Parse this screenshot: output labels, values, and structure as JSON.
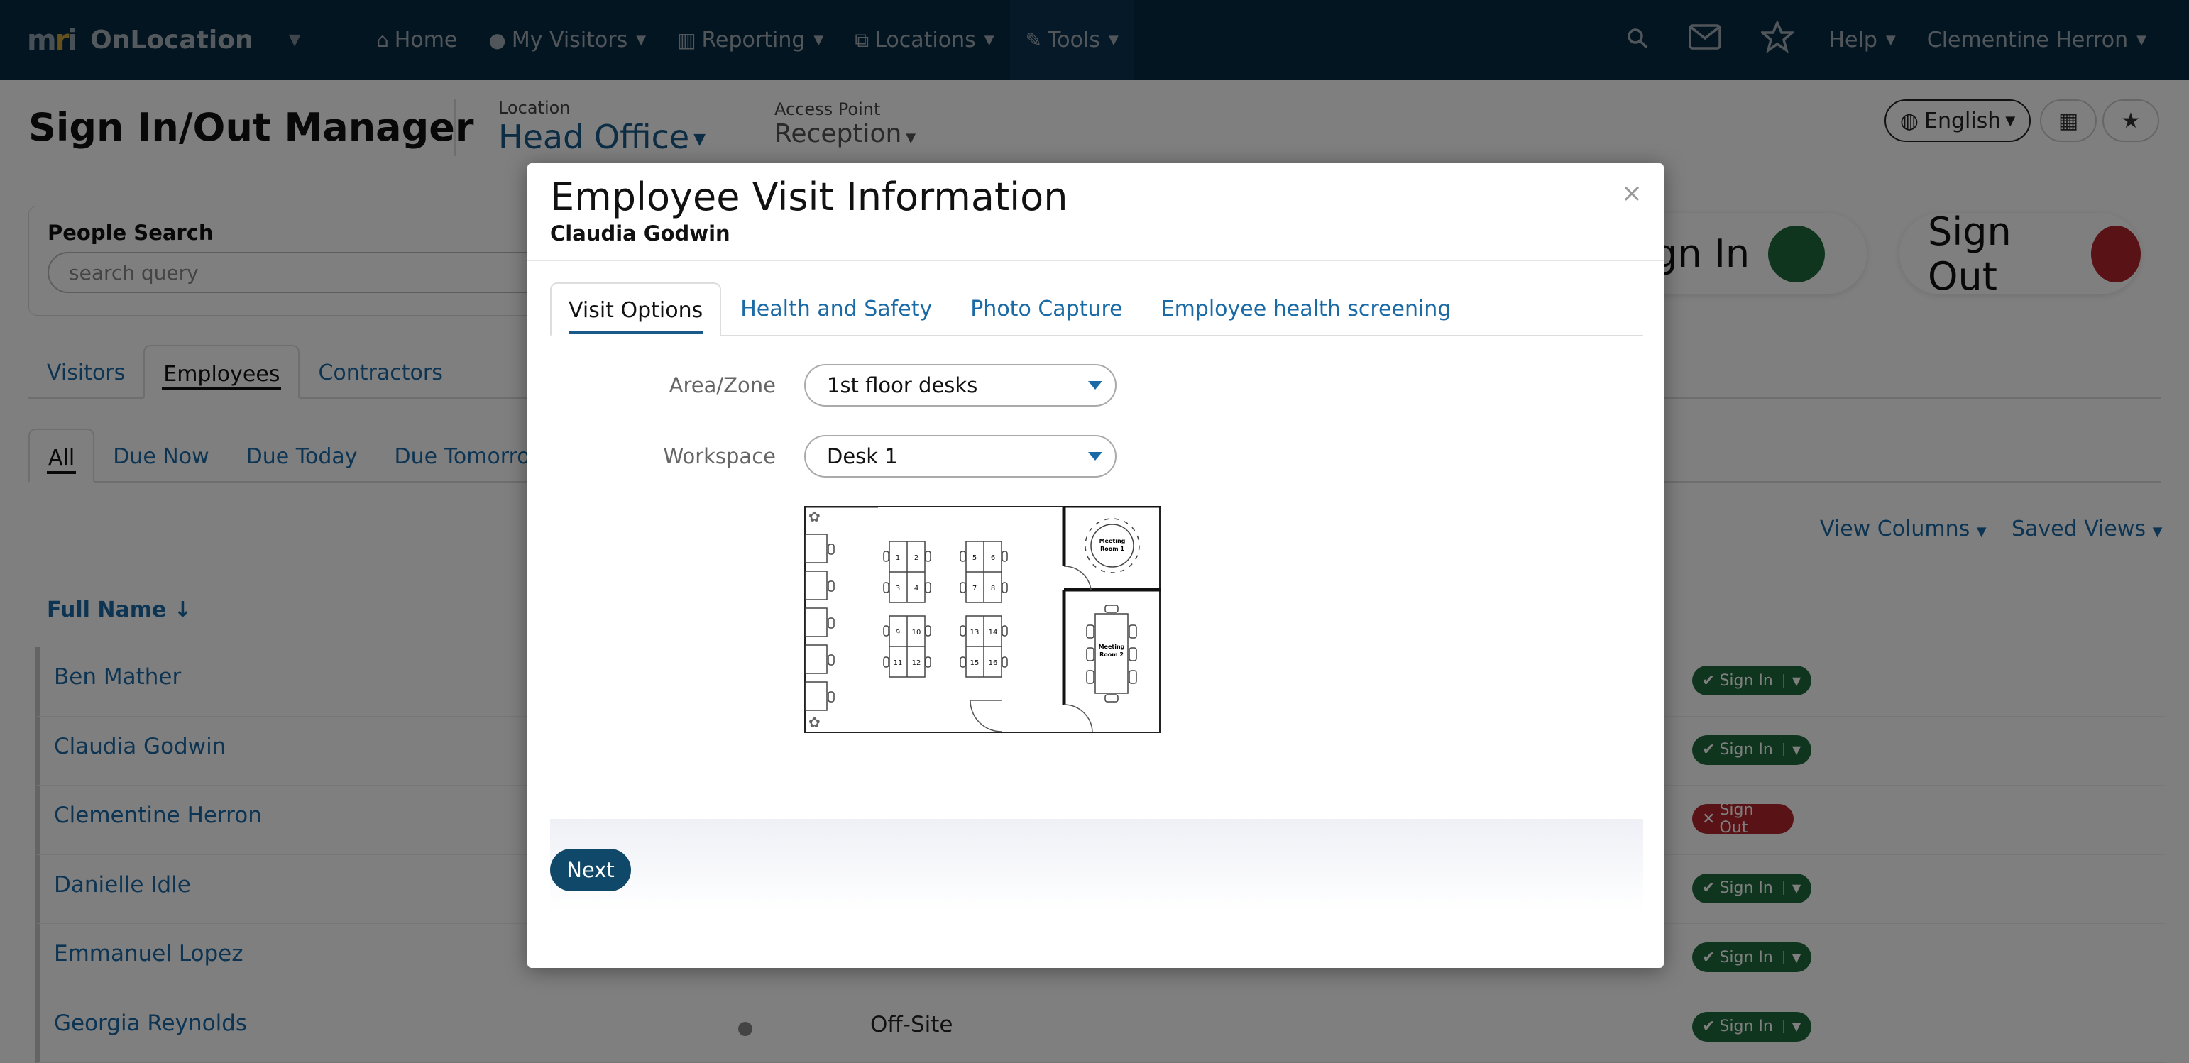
{
  "navbar": {
    "brand": "OnLocation",
    "items": [
      {
        "icon": "home-icon",
        "glyph": "⌂",
        "label": "Home",
        "caret": false
      },
      {
        "icon": "user-icon",
        "glyph": "👤",
        "label": "My Visitors",
        "caret": true
      },
      {
        "icon": "chart-icon",
        "glyph": "📊",
        "label": "Reporting",
        "caret": true
      },
      {
        "icon": "sitemap-icon",
        "glyph": "⧉",
        "label": "Locations",
        "caret": true
      },
      {
        "icon": "wrench-icon",
        "glyph": "🔧",
        "label": "Tools",
        "caret": true
      }
    ],
    "help_label": "Help",
    "user_name": "Clementine Herron"
  },
  "header": {
    "title": "Sign In/Out Manager",
    "location_label": "Location",
    "location_value": "Head Office",
    "access_point_label": "Access Point",
    "access_point_value": "Reception",
    "language": "English"
  },
  "search": {
    "label": "People Search",
    "placeholder": "search query"
  },
  "actions": {
    "sign_in": "Sign In",
    "sign_out": "Sign Out"
  },
  "tabs_primary": [
    "Visitors",
    "Employees",
    "Contractors"
  ],
  "tabs_secondary": [
    "All",
    "Due Now",
    "Due Today",
    "Due Tomorrow"
  ],
  "view_columns": "View Columns",
  "saved_views": "Saved Views",
  "column_full_name": "Full Name",
  "rows": [
    {
      "name": "Ben Mather",
      "status": "in",
      "badge": "Sign In",
      "where": ""
    },
    {
      "name": "Claudia Godwin",
      "status": "in",
      "badge": "Sign In",
      "where": ""
    },
    {
      "name": "Clementine Herron",
      "status": "out",
      "badge": "Sign Out",
      "where": ""
    },
    {
      "name": "Danielle Idle",
      "status": "in",
      "badge": "Sign In",
      "where": ""
    },
    {
      "name": "Emmanuel Lopez",
      "status": "in",
      "badge": "Sign In",
      "where": ""
    },
    {
      "name": "Georgia Reynolds",
      "status": "in",
      "badge": "Sign In",
      "where": "Off-Site"
    }
  ],
  "modal": {
    "title": "Employee Visit Information",
    "subtitle": "Claudia Godwin",
    "tabs": [
      "Visit Options",
      "Health and Safety",
      "Photo Capture",
      "Employee health screening"
    ],
    "area_label": "Area/Zone",
    "area_value": "1st floor desks",
    "workspace_label": "Workspace",
    "workspace_value": "Desk 1",
    "next": "Next",
    "floorplan": {
      "meeting_room_1": [
        "Meeting",
        "Room 1"
      ],
      "meeting_room_2": [
        "Meeting",
        "Room 2"
      ],
      "desks": [
        "1",
        "2",
        "3",
        "4",
        "5",
        "6",
        "7",
        "8",
        "9",
        "10",
        "11",
        "12",
        "13",
        "14",
        "15",
        "16"
      ]
    }
  },
  "colors": {
    "navbar": "#082a44",
    "link": "#1a6aa6",
    "sign_in_dot": "#1f6b3c",
    "sign_out_dot": "#b3262c",
    "next_button": "#0f4868"
  }
}
